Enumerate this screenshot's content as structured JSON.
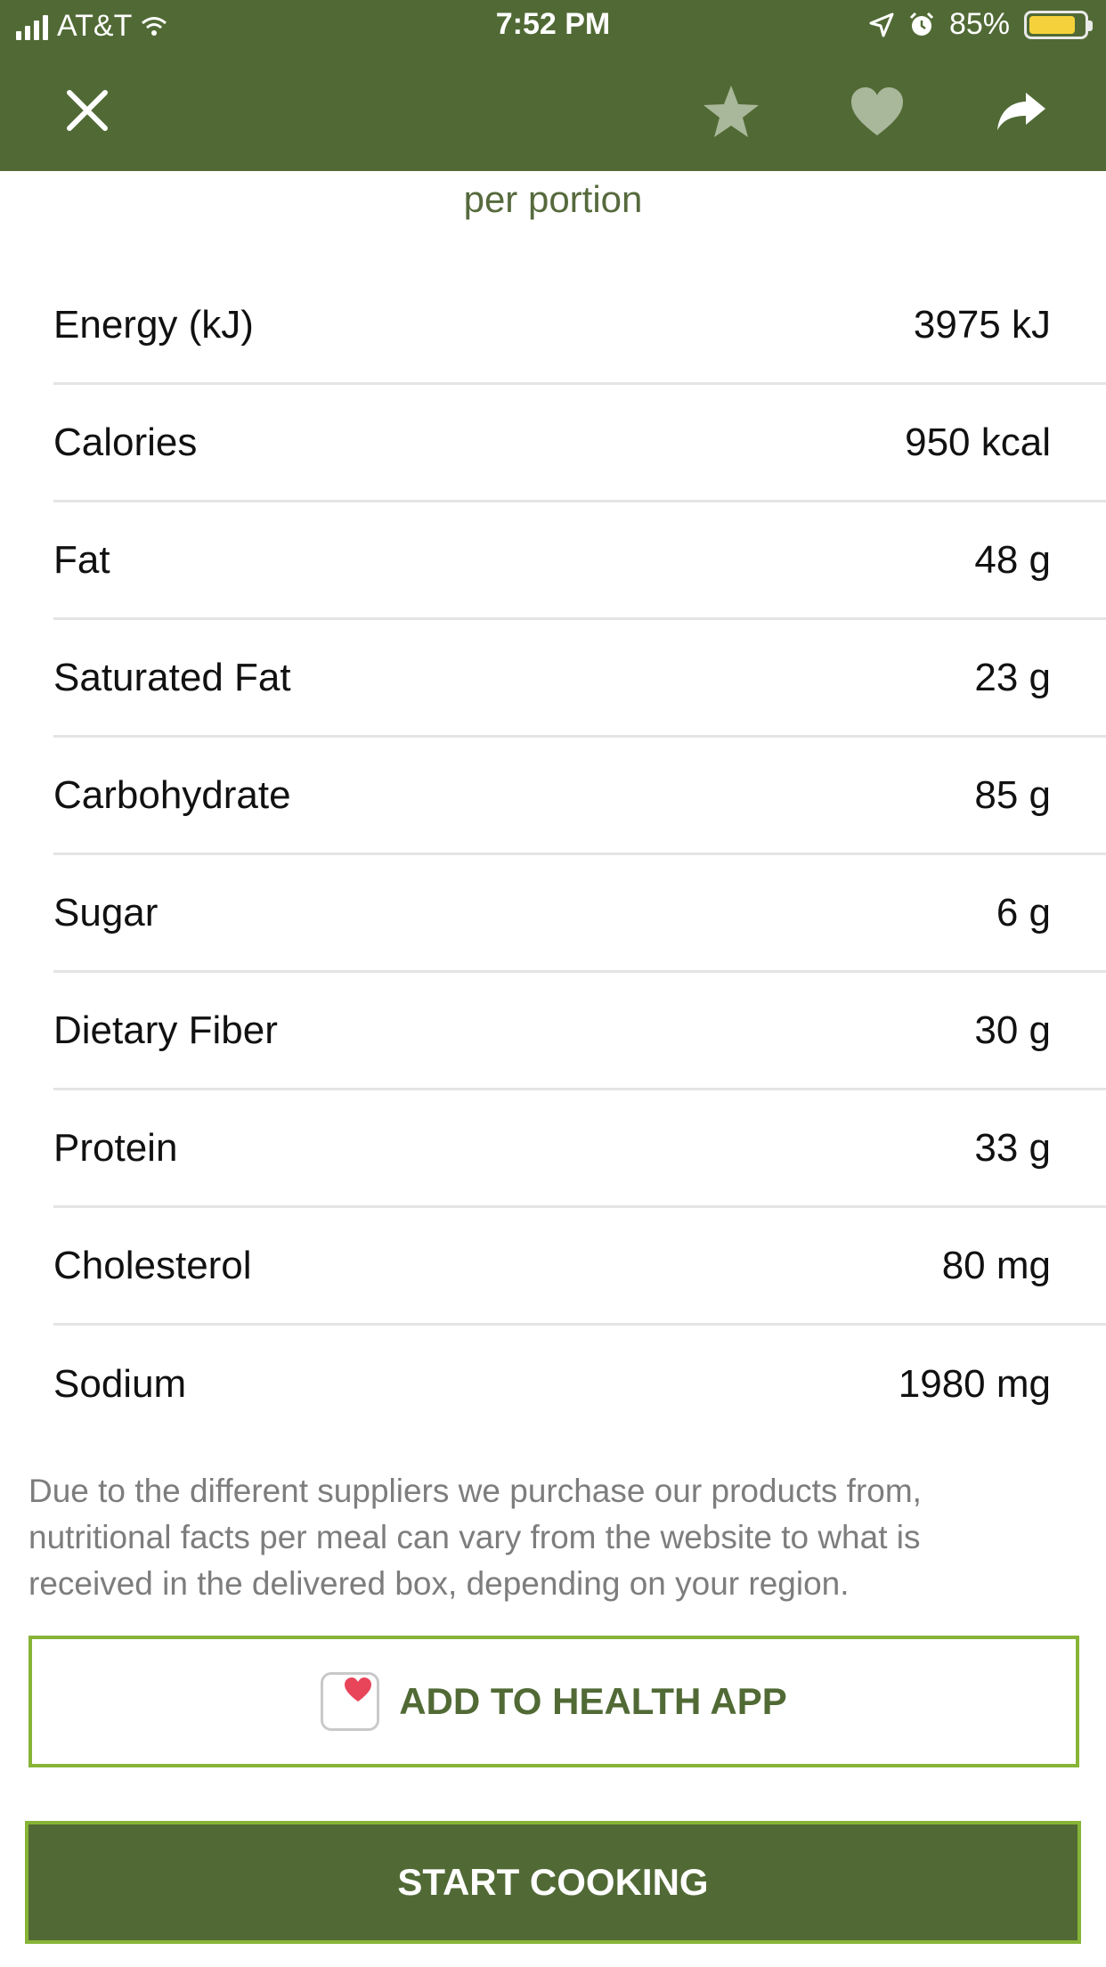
{
  "status_bar": {
    "carrier": "AT&T",
    "time": "7:52 PM",
    "battery": "85%",
    "battery_fraction": 0.85,
    "icons": [
      "signal-icon",
      "wifi-icon",
      "location-icon",
      "alarm-icon",
      "battery-icon"
    ]
  },
  "header": {
    "icons": [
      "close-icon",
      "star-icon",
      "heart-icon",
      "share-icon"
    ]
  },
  "subtitle": "per portion",
  "nutrients": [
    {
      "name": "Energy (kJ)",
      "value": "3975 kJ"
    },
    {
      "name": "Calories",
      "value": "950 kcal"
    },
    {
      "name": "Fat",
      "value": "48 g"
    },
    {
      "name": "Saturated Fat",
      "value": "23 g"
    },
    {
      "name": "Carbohydrate",
      "value": "85 g"
    },
    {
      "name": "Sugar",
      "value": "6 g"
    },
    {
      "name": "Dietary Fiber",
      "value": "30 g"
    },
    {
      "name": "Protein",
      "value": "33 g"
    },
    {
      "name": "Cholesterol",
      "value": "80 mg"
    },
    {
      "name": "Sodium",
      "value": "1980 mg"
    }
  ],
  "disclaimer": "Due to the different suppliers we purchase our products from, nutritional facts per meal can vary from the website to what is received in the delivered box, depending on your region.",
  "buttons": {
    "health": "ADD TO HEALTH APP",
    "cook": "START COOKING"
  },
  "colors": {
    "brand_green": "#516a35",
    "accent_border": "#87b437",
    "heart_red": "#e8445a"
  }
}
